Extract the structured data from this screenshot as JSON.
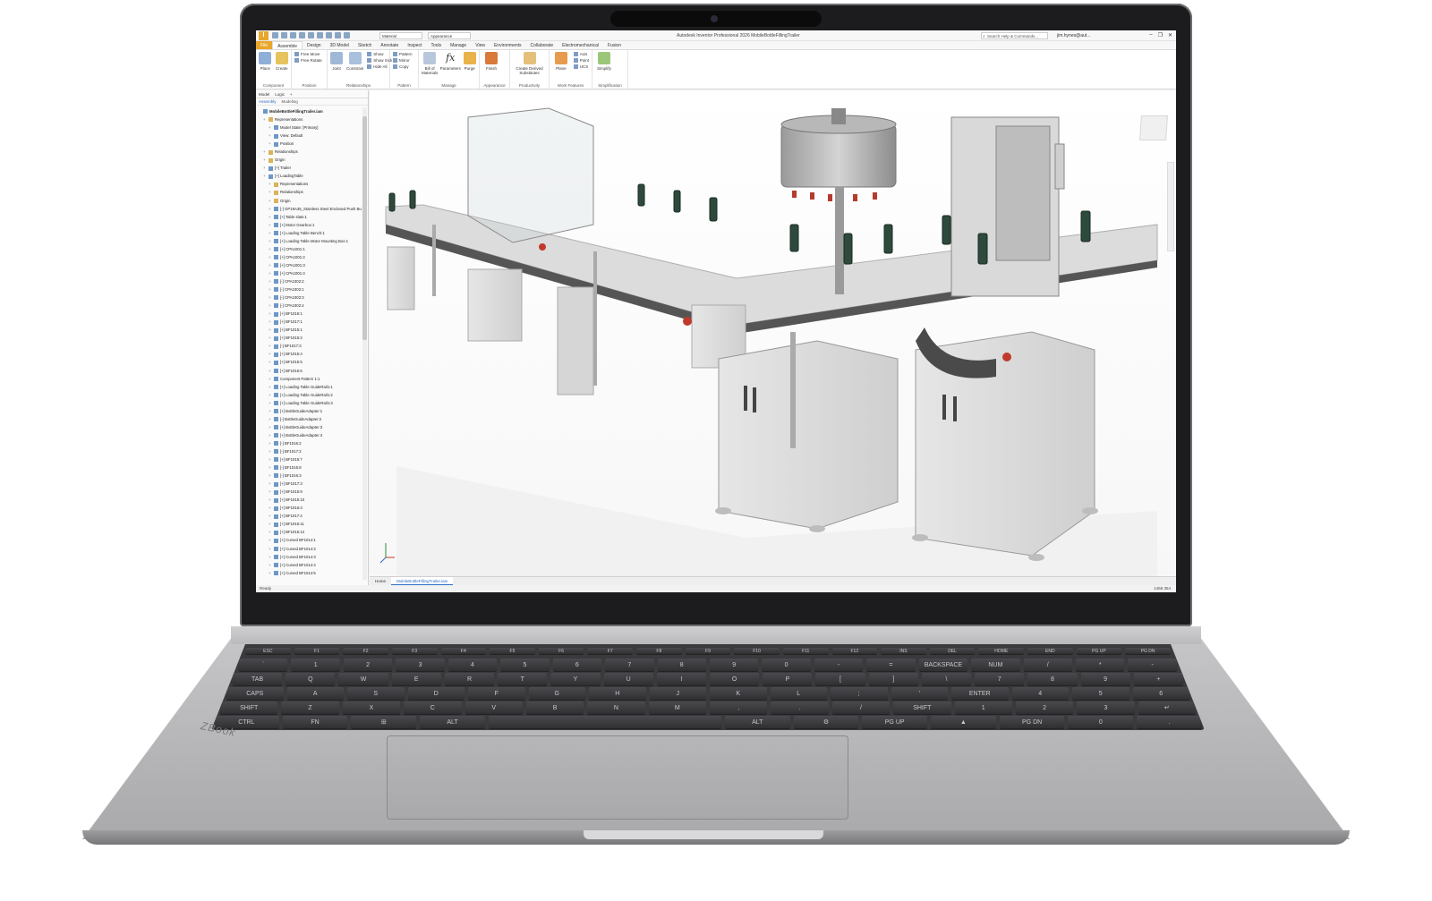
{
  "app": {
    "title": "Autodesk Inventor Professional 2026   MobileBottleFillingTrailer",
    "logo": "I",
    "material": "Material",
    "appearance": "Appearance",
    "search_placeholder": "Search Help & Commands...",
    "user": "jim.hynes@aut...",
    "win_controls": [
      "–",
      "❐",
      "✕"
    ]
  },
  "menu_tabs": [
    "File",
    "Assemble",
    "Design",
    "3D Model",
    "Sketch",
    "Annotate",
    "Inspect",
    "Tools",
    "Manage",
    "View",
    "Environments",
    "Collaborate",
    "Electromechanical",
    "Fusion"
  ],
  "active_tab": "Assemble",
  "ribbon": {
    "component": {
      "name": "Component",
      "place": "Place",
      "create": "Create"
    },
    "position": {
      "name": "Position",
      "free_move": "Free Move",
      "free_rotate": "Free Rotate"
    },
    "relationships": {
      "name": "Relationships",
      "joint": "Joint",
      "constrain": "Constrain",
      "show": "Show",
      "show_sick": "Show Sick",
      "hide_all": "Hide All"
    },
    "pattern": {
      "name": "Pattern",
      "pattern": "Pattern",
      "mirror": "Mirror",
      "copy": "Copy"
    },
    "manage": {
      "name": "Manage",
      "bom": "Bill of Materials",
      "parameters": "Parameters",
      "purge": "Purge"
    },
    "appearance": {
      "name": "Appearance",
      "finish": "Finish"
    },
    "productivity": {
      "name": "Productivity",
      "create_derived": "Create Derived Substitutes"
    },
    "work_features": {
      "name": "Work Features",
      "plane": "Plane",
      "axis": "Axis",
      "point": "Point",
      "ucs": "UCS"
    },
    "simplification": {
      "name": "Simplification",
      "simplify": "Simplify"
    }
  },
  "browser": {
    "tabs": [
      "Model",
      "Logic",
      "+"
    ],
    "subtabs": [
      "Assembly",
      "Modeling"
    ],
    "items": [
      {
        "label": "MobileBottleFillingTrailer.iam",
        "level": 0,
        "root": true
      },
      {
        "label": "Representations",
        "level": 1,
        "folder": true
      },
      {
        "label": "Model State: [Primary]",
        "level": 2
      },
      {
        "label": "View: Default",
        "level": 2
      },
      {
        "label": "Position",
        "level": 2
      },
      {
        "label": "Relationships",
        "level": 1,
        "folder": true
      },
      {
        "label": "Origin",
        "level": 1,
        "folder": true
      },
      {
        "label": "[+] Trailer",
        "level": 1
      },
      {
        "label": "[+] LoadingTable",
        "level": 1
      },
      {
        "label": "Representations",
        "level": 2,
        "folder": true
      },
      {
        "label": "Relationships",
        "level": 2,
        "folder": true
      },
      {
        "label": "Origin",
        "level": 2,
        "folder": true
      },
      {
        "label": "[-] GP19A35_Stainless Steel Enclosed Push Button Sw",
        "level": 2
      },
      {
        "label": "[+] Table slats:1",
        "level": 2
      },
      {
        "label": "[+] Motor Gearbox:1",
        "level": 2
      },
      {
        "label": "[+] Loading Table Bench:1",
        "level": 2
      },
      {
        "label": "[+] Loading Table Motor Mounting Box:1",
        "level": 2
      },
      {
        "label": "[+] CPA1001:1",
        "level": 2
      },
      {
        "label": "[+] CPA1001:2",
        "level": 2
      },
      {
        "label": "[+] CPA1001:3",
        "level": 2
      },
      {
        "label": "[+] CPA1001:4",
        "level": 2
      },
      {
        "label": "[-] CPA1002:2",
        "level": 2
      },
      {
        "label": "[-] CPA1002:1",
        "level": 2
      },
      {
        "label": "[-] CPA1002:3",
        "level": 2
      },
      {
        "label": "[-] CPA1002:4",
        "level": 2
      },
      {
        "label": "[+] BF1016:1",
        "level": 2
      },
      {
        "label": "[+] BF1017:1",
        "level": 2
      },
      {
        "label": "[+] BF1015:1",
        "level": 2
      },
      {
        "label": "[+] BF1015:2",
        "level": 2
      },
      {
        "label": "[-] BF1017:3",
        "level": 2
      },
      {
        "label": "[+] BF1015:4",
        "level": 2
      },
      {
        "label": "[+] BF1015:5",
        "level": 2
      },
      {
        "label": "[+] BF1015:6",
        "level": 2
      },
      {
        "label": "Component Pattern 1:1",
        "level": 2
      },
      {
        "label": "[+] Loading Table GuideRail1:1",
        "level": 2
      },
      {
        "label": "[+] Loading Table GuideRail1:2",
        "level": 2
      },
      {
        "label": "[+] Loading Table GuideRail1:3",
        "level": 2
      },
      {
        "label": "[+] BottleGuideAdapter:1",
        "level": 2
      },
      {
        "label": "[-] BottleGuideAdapter:2",
        "level": 2
      },
      {
        "label": "[+] BottleGuideAdapter:3",
        "level": 2
      },
      {
        "label": "[+] BottleGuideAdapter:4",
        "level": 2
      },
      {
        "label": "[-] BF1016:2",
        "level": 2
      },
      {
        "label": "[-] BF1017:2",
        "level": 2
      },
      {
        "label": "[+] BF1015:7",
        "level": 2
      },
      {
        "label": "[-] BF1015:8",
        "level": 2
      },
      {
        "label": "[-] BF1016:3",
        "level": 2
      },
      {
        "label": "[+] BF1017:3",
        "level": 2
      },
      {
        "label": "[+] BF1015:9",
        "level": 2
      },
      {
        "label": "[+] BF1015:10",
        "level": 2
      },
      {
        "label": "[+] BF1016:4",
        "level": 2
      },
      {
        "label": "[+] BF1017:4",
        "level": 2
      },
      {
        "label": "[+] BF1015:11",
        "level": 2
      },
      {
        "label": "[+] BF1015:12",
        "level": 2
      },
      {
        "label": "[+] Curved BF1014:1",
        "level": 2
      },
      {
        "label": "[+] Curved BF1014:2",
        "level": 2
      },
      {
        "label": "[+] Curved BF1014:3",
        "level": 2
      },
      {
        "label": "[+] Curved BF1014:4",
        "level": 2
      },
      {
        "label": "[+] Curved BF1014:5",
        "level": 2
      }
    ]
  },
  "doc_tabs": [
    "Home",
    "MobileBottleFillingTrailer.iam"
  ],
  "status": {
    "text": "Ready",
    "counts": "1456   354"
  },
  "laptop": {
    "brand": "ZBook",
    "keyboard_rows": [
      [
        "ESC",
        "F1",
        "F2",
        "F3",
        "F4",
        "F5",
        "F6",
        "F7",
        "F8",
        "F9",
        "F10",
        "F11",
        "F12",
        "INS",
        "DEL",
        "HOME",
        "END",
        "PG UP",
        "PG DN"
      ],
      [
        "`",
        "1",
        "2",
        "3",
        "4",
        "5",
        "6",
        "7",
        "8",
        "9",
        "0",
        "-",
        "=",
        "BACKSPACE",
        "NUM",
        "/",
        "*",
        "-"
      ],
      [
        "TAB",
        "Q",
        "W",
        "E",
        "R",
        "T",
        "Y",
        "U",
        "I",
        "O",
        "P",
        "[",
        "]",
        "\\",
        "7",
        "8",
        "9",
        "+"
      ],
      [
        "CAPS",
        "A",
        "S",
        "D",
        "F",
        "G",
        "H",
        "J",
        "K",
        "L",
        ";",
        "'",
        "ENTER",
        "4",
        "5",
        "6"
      ],
      [
        "SHIFT",
        "Z",
        "X",
        "C",
        "V",
        "B",
        "N",
        "M",
        ",",
        ".",
        "/",
        "SHIFT",
        "1",
        "2",
        "3",
        "↵"
      ],
      [
        "CTRL",
        "FN",
        "⊞",
        "ALT",
        "",
        "ALT",
        "⚙",
        "PG UP",
        "▲",
        "PG DN",
        "0",
        "."
      ]
    ]
  },
  "colors": {
    "accent_orange": "#e8a72c",
    "link_blue": "#2b6cc4",
    "chassis": "#b9b9bb",
    "bezel": "#1c1c1e"
  }
}
